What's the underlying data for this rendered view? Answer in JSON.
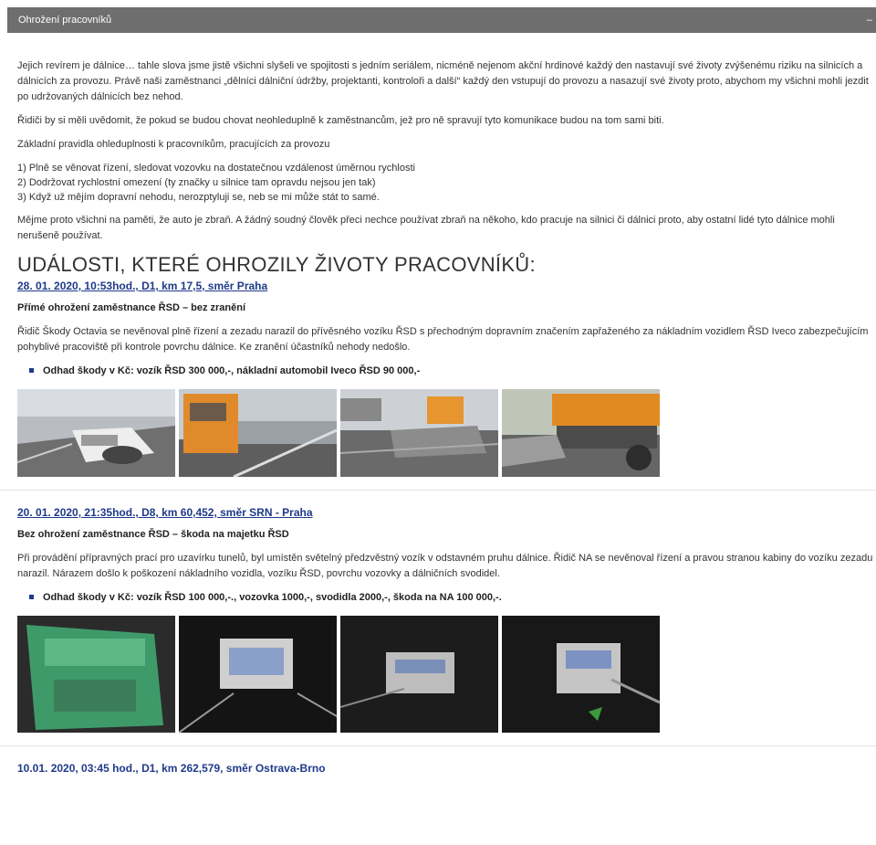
{
  "panel": {
    "title": "Ohrožení pracovníků",
    "collapse_icon": "minus-icon"
  },
  "intro": {
    "p1": "Jejich revírem je dálnice… tahle slova jsme jistě všichni slyšeli ve spojitosti s jedním seriálem, nicméně nejenom akční hrdinové každý den nastavují své životy zvýšenému riziku na silnicích a dálnicích za provozu. Právě naši zaměstnanci „dělníci dálniční údržby, projektanti, kontroloři a další“ každý den vstupují do provozu a nasazují své životy proto, abychom my všichni mohli jezdit po udržovaných dálnicích bez nehod.",
    "p2": "Řidiči by si měli uvědomit, že pokud se budou chovat neohleduplně k zaměstnancům, jež pro ně spravují tyto komunikace budou na tom sami biti.",
    "p3": "Základní pravidla ohleduplnosti k pracovníkům, pracujících za provozu",
    "rules": [
      "1) Plně se věnovat řízení, sledovat vozovku na dostatečnou vzdálenost úměrnou rychlosti",
      "2) Dodržovat rychlostní omezení (ty značky u silnice tam opravdu nejsou jen tak)",
      "3) Když už mějím dopravní nehodu, nerozptyluji se, neb se mi může stát to samé."
    ],
    "p4": "Mějme proto všichni na paměti, že auto je zbraň. A žádný soudný člověk přeci nechce používat zbraň na někoho, kdo pracuje na silnici či dálnici proto, aby ostatní lidé tyto dálnice mohli nerušeně používat."
  },
  "events_heading": "UDÁLOSTI, KTERÉ OHROZILY ŽIVOTY PRACOVNÍKŮ:",
  "events": [
    {
      "title": "28. 01. 2020, 10:53hod., D1, km 17,5, směr Praha",
      "subtitle": "Přímé ohrožení zaměstnance ŘSD – bez zranění",
      "description": "Řidič Škody Octavia se nevěnoval plně řízení a zezadu narazil do přívěsného vozíku ŘSD s přechodným dopravním značením zapřaženého za nákladním vozidlem ŘSD Iveco zabezpečujícím pohyblivé pracoviště při kontrole povrchu dálnice. Ke zranění účastníků nehody nedošlo.",
      "damage": "Odhad škody v Kč: vozík ŘSD 300 000,-, nákladní automobil Iveco ŘSD 90 000,-"
    },
    {
      "title": "20. 01. 2020, 21:35hod., D8, km 60,452, směr SRN - Praha",
      "subtitle": "Bez ohrožení zaměstnance ŘSD – škoda na majetku ŘSD",
      "description": "Při provádění přípravných prací pro uzavírku tunelů, byl umístěn světelný předzvěstný vozík v odstavném pruhu dálnice. Řidič NA se nevěnoval řízení a pravou stranou kabiny do vozíku zezadu narazil. Nárazem došlo k poškození nákladního vozidla, vozíku ŘSD, povrchu vozovky a dálničních svodidel.",
      "damage": "Odhad škody v Kč: vozík ŘSD 100 000,-., vozovka 1000,-, svodidla 2000,-, škoda na NA 100 000,-."
    },
    {
      "title": "10.01. 2020, 03:45 hod., D1, km 262,579, směr Ostrava-Brno"
    }
  ],
  "colors": {
    "header_bg": "#6e6e6e",
    "link": "#1f3a8a",
    "text": "#333333"
  }
}
